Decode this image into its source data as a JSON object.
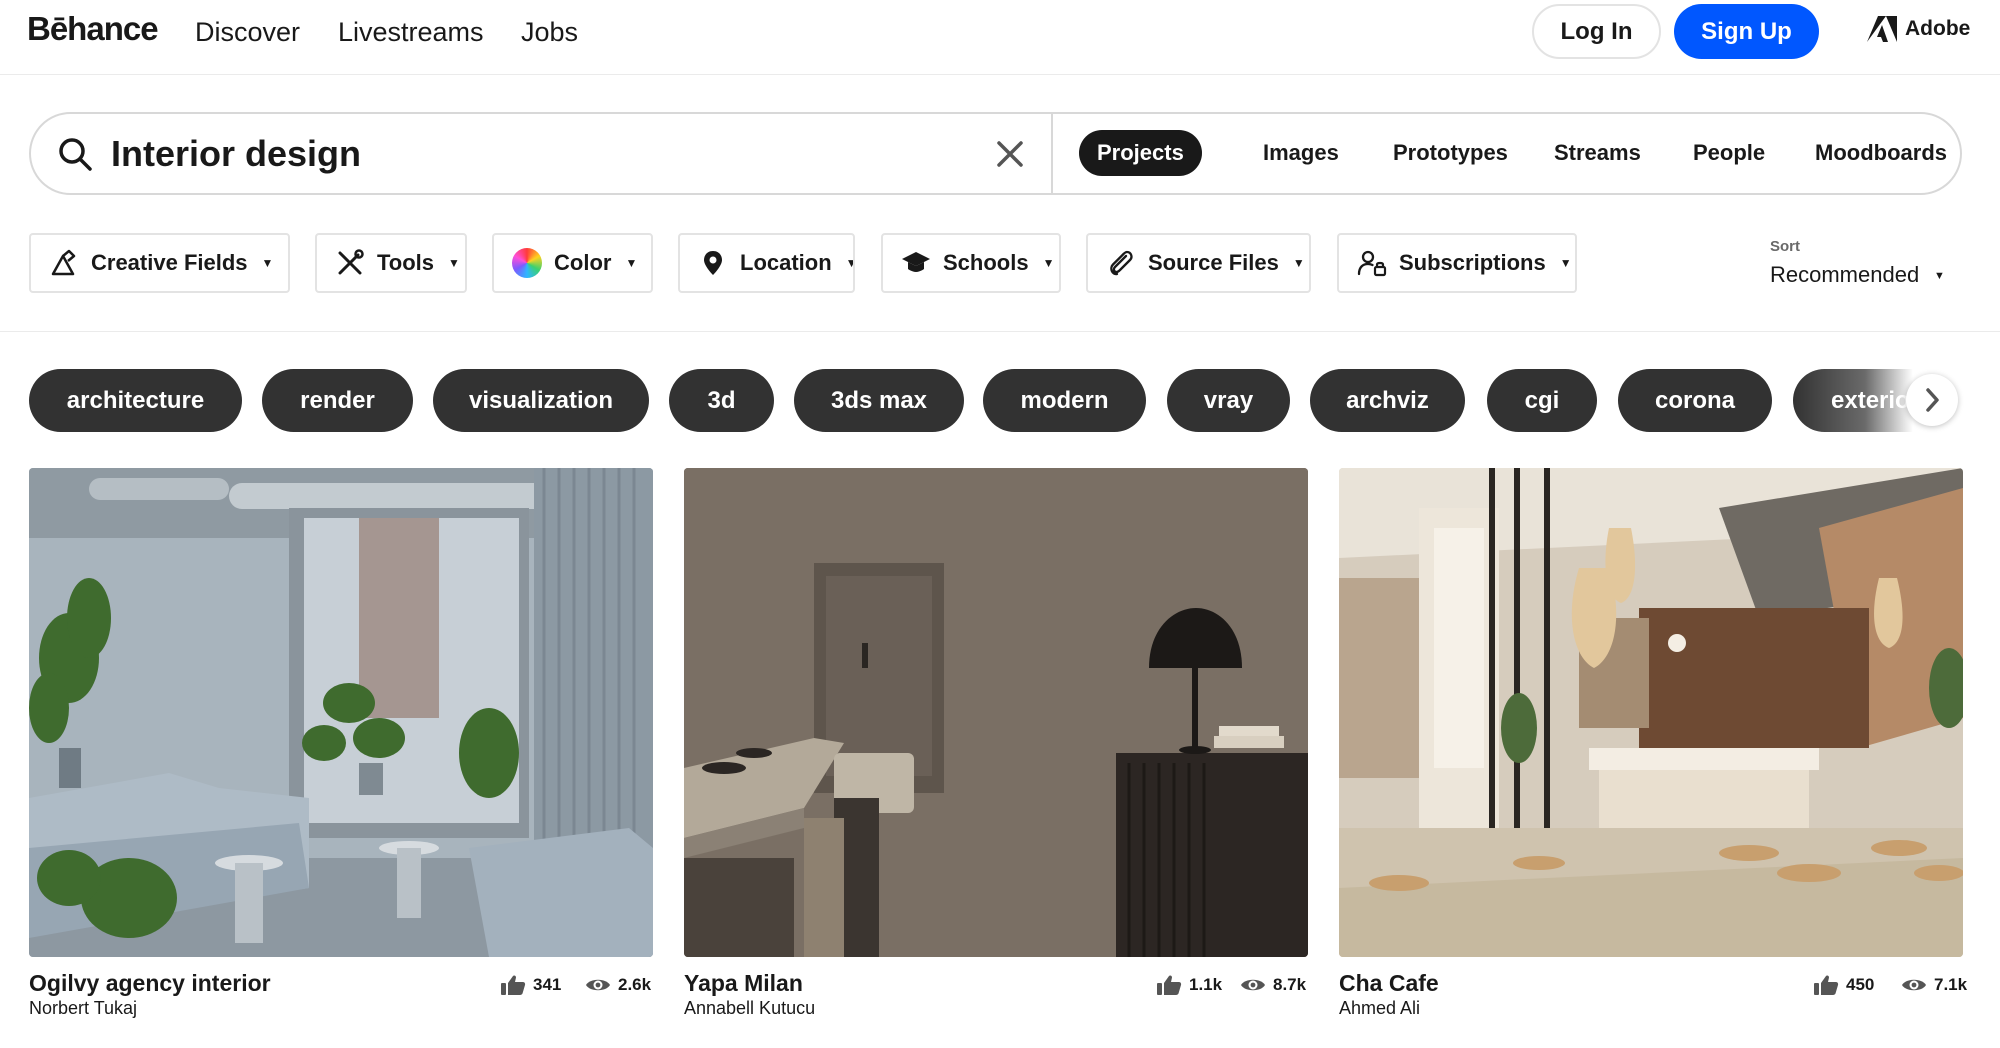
{
  "header": {
    "logo": "Bēhance",
    "nav": [
      "Discover",
      "Livestreams",
      "Jobs"
    ],
    "login_label": "Log In",
    "signup_label": "Sign Up",
    "adobe_label": "Adobe"
  },
  "search": {
    "query": "Interior design",
    "types": [
      {
        "label": "Projects",
        "active": true
      },
      {
        "label": "Images",
        "active": false
      },
      {
        "label": "Prototypes",
        "active": false
      },
      {
        "label": "Streams",
        "active": false
      },
      {
        "label": "People",
        "active": false
      },
      {
        "label": "Moodboards",
        "active": false
      }
    ]
  },
  "filters": [
    {
      "label": "Creative Fields",
      "icon": "creative-fields-icon"
    },
    {
      "label": "Tools",
      "icon": "tools-icon"
    },
    {
      "label": "Color",
      "icon": "color-wheel-icon"
    },
    {
      "label": "Location",
      "icon": "location-pin-icon"
    },
    {
      "label": "Schools",
      "icon": "graduation-cap-icon"
    },
    {
      "label": "Source Files",
      "icon": "paperclip-icon"
    },
    {
      "label": "Subscriptions",
      "icon": "subscriptions-icon"
    }
  ],
  "sort": {
    "label": "Sort",
    "value": "Recommended"
  },
  "tags": [
    "architecture",
    "render",
    "visualization",
    "3d",
    "3ds max",
    "modern",
    "vray",
    "archviz",
    "cgi",
    "corona",
    "exterior"
  ],
  "projects": [
    {
      "title": "Ogilvy agency interior",
      "author": "Norbert Tukaj",
      "likes": "341",
      "views": "2.6k"
    },
    {
      "title": "Yapa Milan",
      "author": "Annabell Kutucu",
      "likes": "1.1k",
      "views": "8.7k"
    },
    {
      "title": "Cha Cafe",
      "author": "Ahmed Ali",
      "likes": "450",
      "views": "7.1k"
    }
  ],
  "colors": {
    "accent": "#0057ff",
    "tag_bg": "#323232",
    "text": "#191919"
  }
}
